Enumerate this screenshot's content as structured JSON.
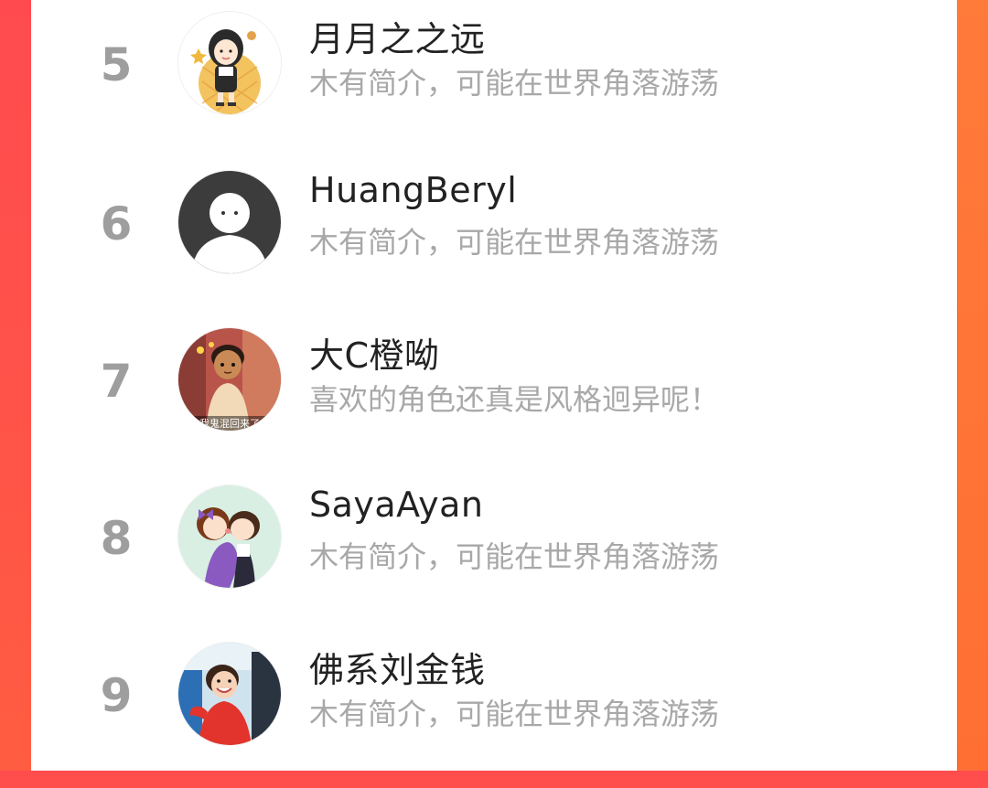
{
  "colors": {
    "rank": "#9e9e9e",
    "name": "#222222",
    "bio": "#a8a8a8",
    "frame_left": "#ff4d4d",
    "frame_right": "#ff7438"
  },
  "users": [
    {
      "rank": "5",
      "name": "月月之之远",
      "bio": "木有简介，可能在世界角落游荡",
      "avatar": "cartoon-girl-avatar"
    },
    {
      "rank": "6",
      "name": "HuangBeryl",
      "bio": "木有简介，可能在世界角落游荡",
      "avatar": "default-user-avatar"
    },
    {
      "rank": "7",
      "name": "大C橙呦",
      "bio": "喜欢的角色还真是风格迥异呢！",
      "avatar": "cartoon-prince-avatar",
      "avatar_caption": "我鬼混回来了"
    },
    {
      "rank": "8",
      "name": "SayaAyan",
      "bio": "木有简介，可能在世界角落游荡",
      "avatar": "cartoon-couple-avatar"
    },
    {
      "rank": "9",
      "name": "佛系刘金钱",
      "bio": "木有简介，可能在世界角落游荡",
      "avatar": "child-photo-avatar"
    }
  ]
}
